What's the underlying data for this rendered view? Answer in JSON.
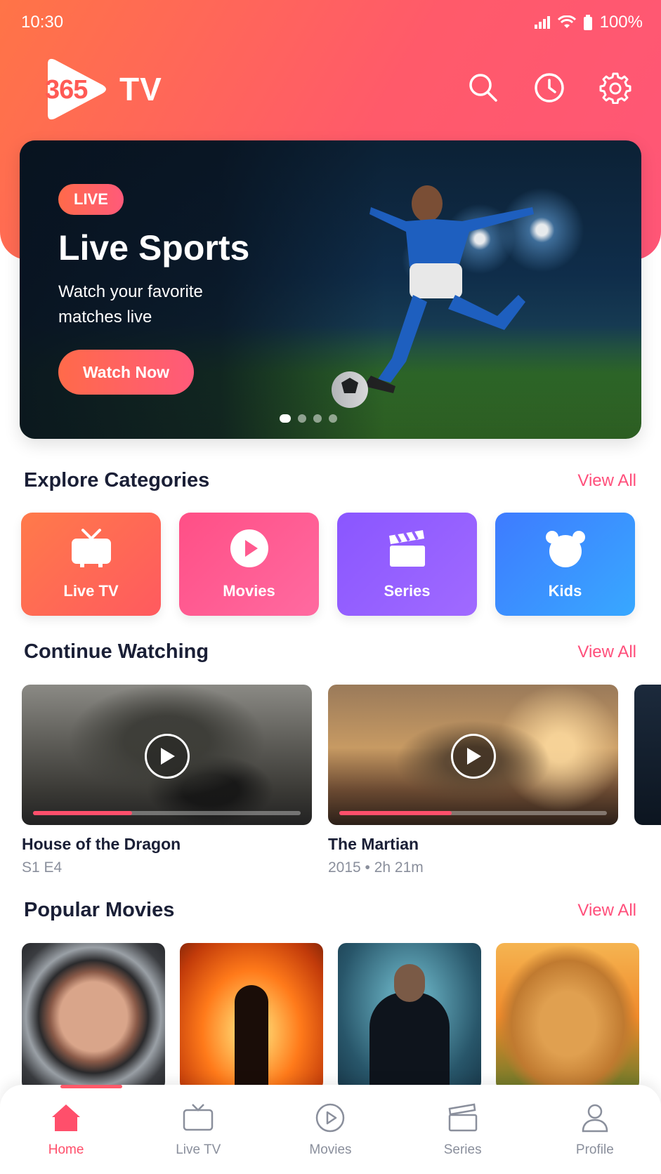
{
  "status_bar": {
    "time": "10:30",
    "battery": "100%"
  },
  "app": {
    "logo_number": "365",
    "logo_text": "TV"
  },
  "icons": {
    "search": "search-icon",
    "history": "clock-icon",
    "settings": "gear-icon"
  },
  "hero": {
    "badge": "LIVE",
    "title": "Live Sports",
    "subtitle": "Watch your favorite matches live",
    "button": "Watch Now",
    "slide_count": 4,
    "active_slide": 1
  },
  "categories": {
    "title": "Explore Categories",
    "view_all": "View All",
    "items": [
      {
        "label": "Live TV",
        "icon": "tv-icon"
      },
      {
        "label": "Movies",
        "icon": "play-icon"
      },
      {
        "label": "Series",
        "icon": "clapperboard-icon"
      },
      {
        "label": "Kids",
        "icon": "teddy-bear-icon"
      }
    ]
  },
  "continue_watching": {
    "title": "Continue Watching",
    "view_all": "View All",
    "items": [
      {
        "title": "House of the Dragon",
        "meta": "S1 E4",
        "progress": 0.37
      },
      {
        "title": "The Martian",
        "meta": "2015 • 2h 21m",
        "progress": 0.42
      }
    ]
  },
  "popular_movies": {
    "title": "Popular Movies",
    "view_all": "View All"
  },
  "bottom_nav": {
    "items": [
      {
        "label": "Home",
        "icon": "home-icon",
        "active": true
      },
      {
        "label": "Live TV",
        "icon": "tv-icon",
        "active": false
      },
      {
        "label": "Movies",
        "icon": "play-circle-icon",
        "active": false
      },
      {
        "label": "Series",
        "icon": "clapperboard-icon",
        "active": false
      },
      {
        "label": "Profile",
        "icon": "user-icon",
        "active": false
      }
    ]
  },
  "colors": {
    "accent": "#ff4f6b",
    "header_start": "#ff7447",
    "header_end": "#ff5677"
  }
}
